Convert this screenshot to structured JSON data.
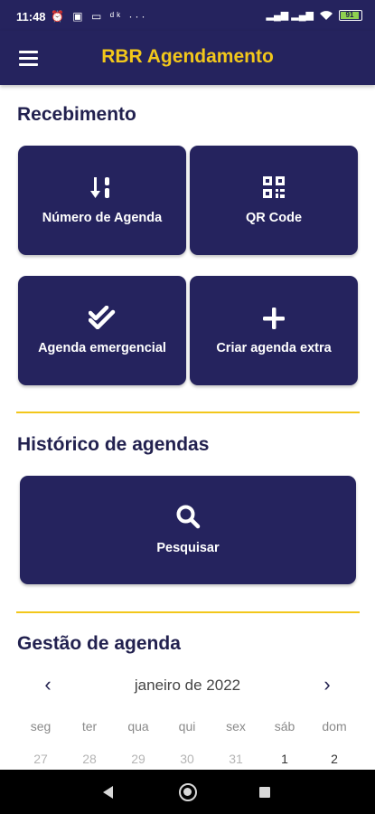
{
  "status_bar": {
    "time": "11:48",
    "left_icons": "⏰ ▣ ▭ ᵈᵏ ···",
    "battery": "91",
    "signal": "▂▄▆ ▂▄▆"
  },
  "app_bar": {
    "title": "RBR Agendamento",
    "menu_icon": "hamburger-icon"
  },
  "recebimento": {
    "title": "Recebimento",
    "tiles": [
      {
        "label": "Número de Agenda",
        "icon": "sort-numeric-down-icon"
      },
      {
        "label": "QR Code",
        "icon": "qr-code-icon"
      },
      {
        "label": "Agenda emergencial",
        "icon": "double-check-icon"
      },
      {
        "label": "Criar agenda extra",
        "icon": "plus-icon"
      }
    ]
  },
  "historico": {
    "title": "Histórico de agendas",
    "search_label": "Pesquisar",
    "search_icon": "search-icon"
  },
  "gestao": {
    "title": "Gestão de agenda",
    "calendar": {
      "month": "janeiro de 2022",
      "prev": "‹",
      "next": "›",
      "weekdays": [
        "seg",
        "ter",
        "qua",
        "qui",
        "sex",
        "sáb",
        "dom"
      ],
      "first_row": [
        "27",
        "28",
        "29",
        "30",
        "31",
        "1",
        "2"
      ]
    }
  },
  "colors": {
    "primary": "#25235e",
    "accent": "#f2c71b"
  }
}
